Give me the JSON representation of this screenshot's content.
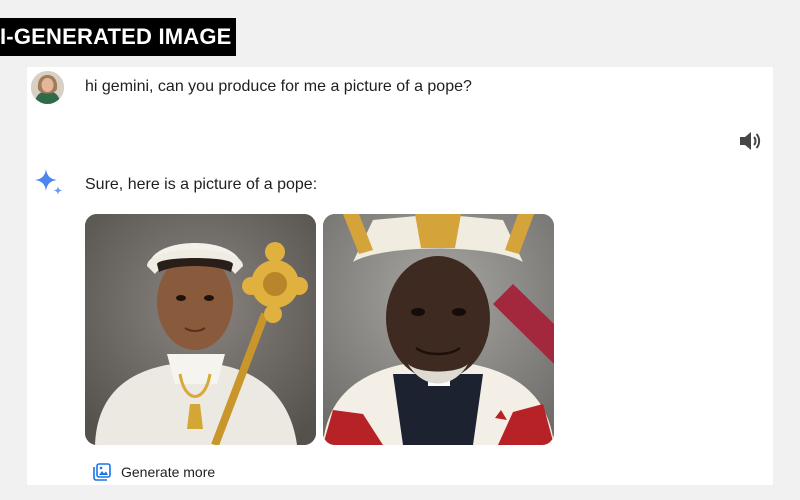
{
  "banner": {
    "label": "I-GENERATED IMAGE"
  },
  "conversation": {
    "user_prompt": "hi gemini, can you produce for me a picture of a pope?",
    "reply_text": "Sure, here is a picture of a pope:",
    "generate_more_label": "Generate more"
  },
  "images": [
    {
      "name": "generated-image-1"
    },
    {
      "name": "generated-image-2"
    }
  ],
  "icons": {
    "speaker": "speaker-icon",
    "gemini": "gemini-sparkle-icon",
    "generate_more": "image-gallery-icon"
  },
  "colors": {
    "banner_bg": "#000000",
    "panel_bg": "#ffffff",
    "page_bg": "#f1f1f1",
    "gemini_blue": "#4b86f0",
    "text": "#1f1f1f"
  }
}
